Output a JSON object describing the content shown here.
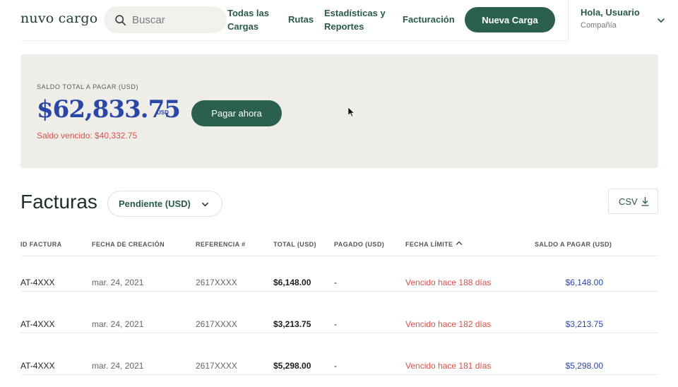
{
  "header": {
    "logo": "nuvo cargo",
    "search": {
      "placeholder": "Buscar",
      "value": ""
    },
    "nav": [
      "Todas las Cargas",
      "Rutas",
      "Estadísticas y Reportes",
      "Facturación"
    ],
    "new_button": "Nueva Carga",
    "user": {
      "greeting": "Hola, Usuario",
      "company": "Compañía"
    }
  },
  "balance": {
    "label": "SALDO TOTAL A PAGAR (USD)",
    "amount": "$62,833.75",
    "currency": "USD",
    "overdue": "Saldo vencido: $40,332.75",
    "pay_button": "Pagar ahora"
  },
  "invoices": {
    "title": "Facturas",
    "filter": "Pendiente (USD)",
    "csv": "CSV",
    "columns": [
      "ID FACTURA",
      "FECHA DE CREACIÓN",
      "REFERENCIA #",
      "TOTAL (USD)",
      "PAGADO (USD)",
      "FECHA LÍMITE",
      "SALDO A PAGAR (USD)"
    ],
    "rows": [
      {
        "id": "AT-4XXX",
        "created": "mar. 24, 2021",
        "reference": "2617XXXX",
        "total": "$6,148.00",
        "paid": "-",
        "due": "Vencido hace 188 días",
        "balance": "$6,148.00"
      },
      {
        "id": "AT-4XXX",
        "created": "mar. 24, 2021",
        "reference": "2617XXXX",
        "total": "$3,213.75",
        "paid": "-",
        "due": "Vencido hace 182 días",
        "balance": "$3,213.75"
      },
      {
        "id": "AT-4XXX",
        "created": "mar. 24, 2021",
        "reference": "2617XXXX",
        "total": "$5,298.00",
        "paid": "-",
        "due": "Vencido hace 181 días",
        "balance": "$5,298.00"
      }
    ]
  },
  "colors": {
    "brand_green": "#2b5f4e",
    "accent_blue": "#2a46a6",
    "danger": "#d9534a",
    "card_bg": "#efede8"
  }
}
